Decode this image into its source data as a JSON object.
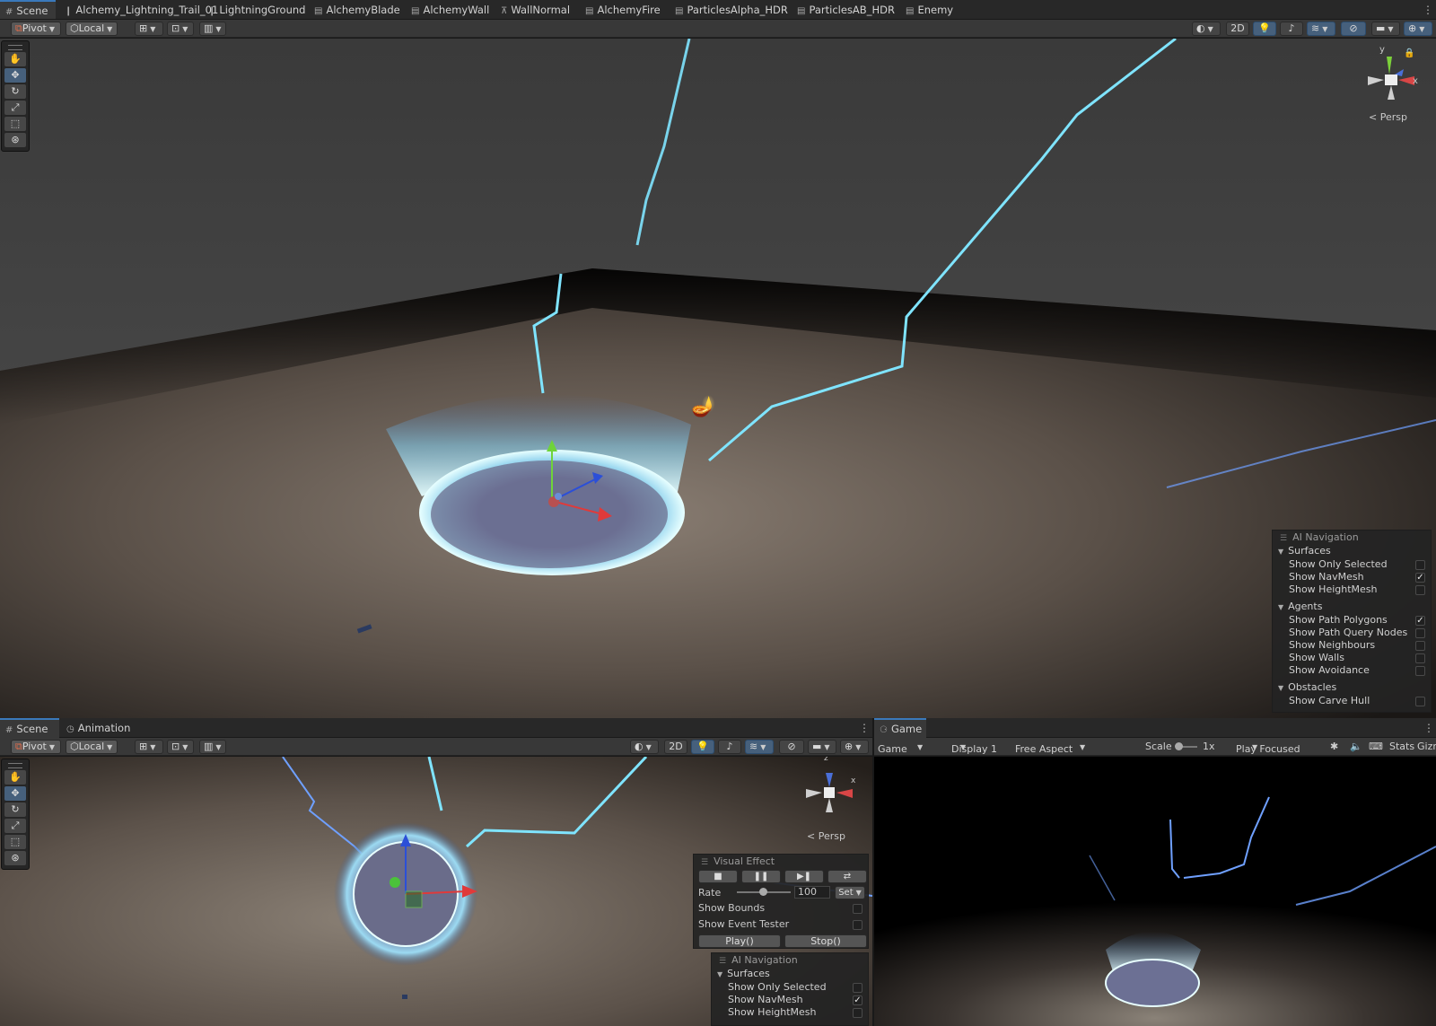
{
  "top_tabs": [
    {
      "label": "Scene",
      "icon": "grid-icon"
    },
    {
      "label": "Alchemy_Lightning_Trail_01",
      "icon": "shader-icon"
    },
    {
      "label": "LightningGround",
      "icon": "shader-icon"
    },
    {
      "label": "AlchemyBlade",
      "icon": "material-icon"
    },
    {
      "label": "AlchemyWall",
      "icon": "material-icon"
    },
    {
      "label": "WallNormal",
      "icon": "texture-icon"
    },
    {
      "label": "AlchemyFire",
      "icon": "material-icon"
    },
    {
      "label": "ParticlesAlpha_HDR",
      "icon": "material-icon"
    },
    {
      "label": "ParticlesAB_HDR",
      "icon": "material-icon"
    },
    {
      "label": "Enemy",
      "icon": "material-icon"
    }
  ],
  "scene_toolbar": {
    "pivot": "Pivot",
    "local": "Local",
    "mode_2d": "2D"
  },
  "gizmo": {
    "y": "y",
    "z": "z",
    "x": "x",
    "persp": "Persp"
  },
  "ai_navigation": {
    "title": "AI Navigation",
    "surfaces": {
      "title": "Surfaces",
      "rows": [
        {
          "label": "Show Only Selected",
          "checked": false
        },
        {
          "label": "Show NavMesh",
          "checked": true
        },
        {
          "label": "Show HeightMesh",
          "checked": false
        }
      ]
    },
    "agents": {
      "title": "Agents",
      "rows": [
        {
          "label": "Show Path Polygons",
          "checked": true
        },
        {
          "label": "Show Path Query Nodes",
          "checked": false
        },
        {
          "label": "Show Neighbours",
          "checked": false
        },
        {
          "label": "Show Walls",
          "checked": false
        },
        {
          "label": "Show Avoidance",
          "checked": false
        }
      ]
    },
    "obstacles": {
      "title": "Obstacles",
      "rows": [
        {
          "label": "Show Carve Hull",
          "checked": false
        }
      ]
    }
  },
  "bottom_left_tabs": [
    {
      "label": "Scene"
    },
    {
      "label": "Animation"
    }
  ],
  "game_tab": {
    "label": "Game"
  },
  "game_bar": {
    "mode": "Game",
    "display": "Display 1",
    "aspect": "Free Aspect",
    "scale_label": "Scale",
    "scale_value": "1x",
    "play_focused": "Play Focused",
    "stats": "Stats",
    "gizmos": "Gizmos"
  },
  "visual_effect": {
    "title": "Visual Effect",
    "rate_label": "Rate",
    "rate_value": "100",
    "set": "Set",
    "show_bounds": "Show Bounds",
    "show_event_tester": "Show Event Tester",
    "play": "Play()",
    "stop": "Stop()"
  },
  "ai_navigation_small": {
    "title": "AI Navigation",
    "section": "Surfaces",
    "rows": [
      {
        "label": "Show Only Selected",
        "checked": false
      },
      {
        "label": "Show NavMesh",
        "checked": true
      },
      {
        "label": "Show HeightMesh",
        "checked": false
      }
    ]
  },
  "colors": {
    "accent": "#3a79bb",
    "lightning": "#7fe4ff",
    "selected_btn": "#46607c"
  }
}
